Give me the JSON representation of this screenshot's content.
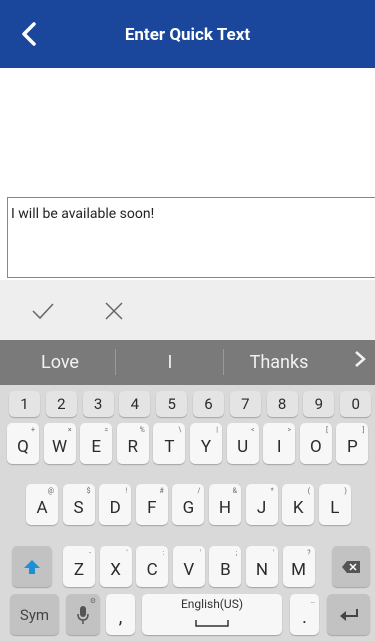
{
  "header": {
    "title": "Enter Quick Text"
  },
  "input": {
    "value": "I will be available soon!"
  },
  "actions": {
    "confirm_icon": "check-icon",
    "cancel_icon": "close-icon"
  },
  "suggestions": [
    "Love",
    "I",
    "Thanks"
  ],
  "keyboard": {
    "numbers": [
      "1",
      "2",
      "3",
      "4",
      "5",
      "6",
      "7",
      "8",
      "9",
      "0"
    ],
    "row1": [
      {
        "k": "Q",
        "s": "+"
      },
      {
        "k": "W",
        "s": "×"
      },
      {
        "k": "E",
        "s": "="
      },
      {
        "k": "R",
        "s": "%"
      },
      {
        "k": "T",
        "s": "\\"
      },
      {
        "k": "Y",
        "s": "|"
      },
      {
        "k": "U",
        "s": "<"
      },
      {
        "k": "I",
        "s": ">"
      },
      {
        "k": "O",
        "s": "["
      },
      {
        "k": "P",
        "s": "]"
      }
    ],
    "row2": [
      {
        "k": "A",
        "s": "@"
      },
      {
        "k": "S",
        "s": "$"
      },
      {
        "k": "D",
        "s": "!"
      },
      {
        "k": "F",
        "s": "#"
      },
      {
        "k": "G",
        "s": "/"
      },
      {
        "k": "H",
        "s": "&"
      },
      {
        "k": "J",
        "s": "*"
      },
      {
        "k": "K",
        "s": "("
      },
      {
        "k": "L",
        "s": ")"
      }
    ],
    "row3": [
      {
        "k": "Z",
        "s": "-"
      },
      {
        "k": "X",
        "s": "'"
      },
      {
        "k": "C",
        "s": ":"
      },
      {
        "k": "V",
        "s": "'"
      },
      {
        "k": "B",
        "s": ";"
      },
      {
        "k": "N",
        "s": "'"
      },
      {
        "k": "M",
        "s": "?"
      }
    ],
    "sym_label": "Sym",
    "comma": ",",
    "space_label": "English(US)",
    "period": ".",
    "colors": {
      "shift": "#1c8fd6",
      "header": "#1a479b"
    }
  }
}
